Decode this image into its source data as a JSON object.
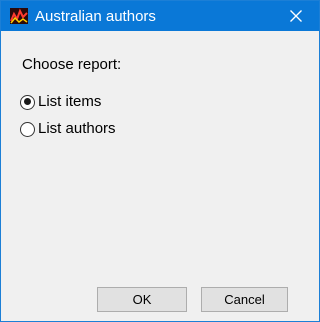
{
  "window": {
    "title": "Australian authors",
    "app_icon": "app-chart-icon",
    "close_icon": "close-icon",
    "accent_color": "#0a78d7"
  },
  "dialog": {
    "prompt": "Choose report:",
    "options": [
      {
        "label": "List items",
        "selected": true
      },
      {
        "label": "List authors",
        "selected": false
      }
    ]
  },
  "buttons": {
    "ok_label": "OK",
    "cancel_label": "Cancel"
  }
}
